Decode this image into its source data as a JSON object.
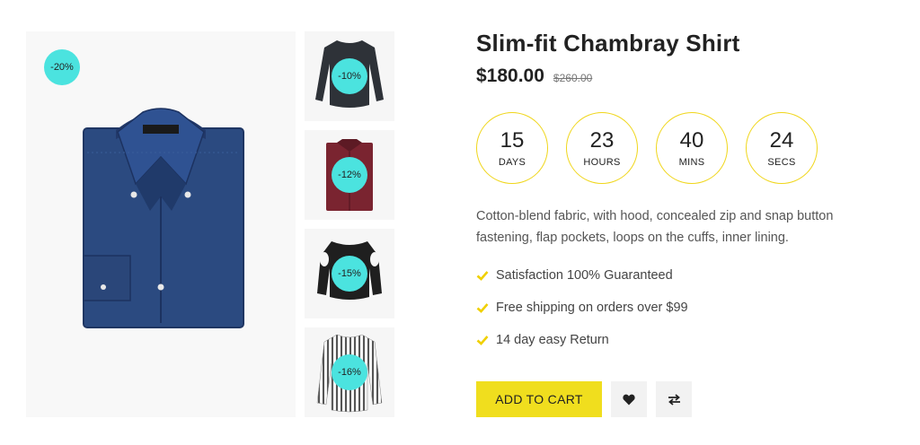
{
  "gallery": {
    "main_badge": "-20%",
    "thumbnails": [
      {
        "badge": "-10%",
        "icon": "black-blouse"
      },
      {
        "badge": "-12%",
        "icon": "burgundy-shirt"
      },
      {
        "badge": "-15%",
        "icon": "black-cold-shoulder-top"
      },
      {
        "badge": "-16%",
        "icon": "striped-shirt"
      }
    ]
  },
  "product": {
    "title": "Slim-fit Chambray Shirt",
    "price": "$180.00",
    "old_price": "$260.00",
    "description": "Cotton-blend fabric, with hood, concealed zip and snap button fastening, flap pockets, loops on the cuffs, inner lining."
  },
  "countdown": [
    {
      "value": "15",
      "label": "DAYS"
    },
    {
      "value": "23",
      "label": "HOURS"
    },
    {
      "value": "40",
      "label": "MINS"
    },
    {
      "value": "24",
      "label": "SECS"
    }
  ],
  "features": [
    "Satisfaction 100% Guaranteed",
    "Free shipping on orders over $99",
    "14 day easy Return"
  ],
  "actions": {
    "add_to_cart": "ADD TO CART",
    "wishlist_icon": "heart-icon",
    "compare_icon": "compare-arrows-icon"
  },
  "colors": {
    "badge": "#4be3df",
    "accent": "#f0de1e",
    "countdown_border": "#f0d61a",
    "check": "#f0d000"
  }
}
